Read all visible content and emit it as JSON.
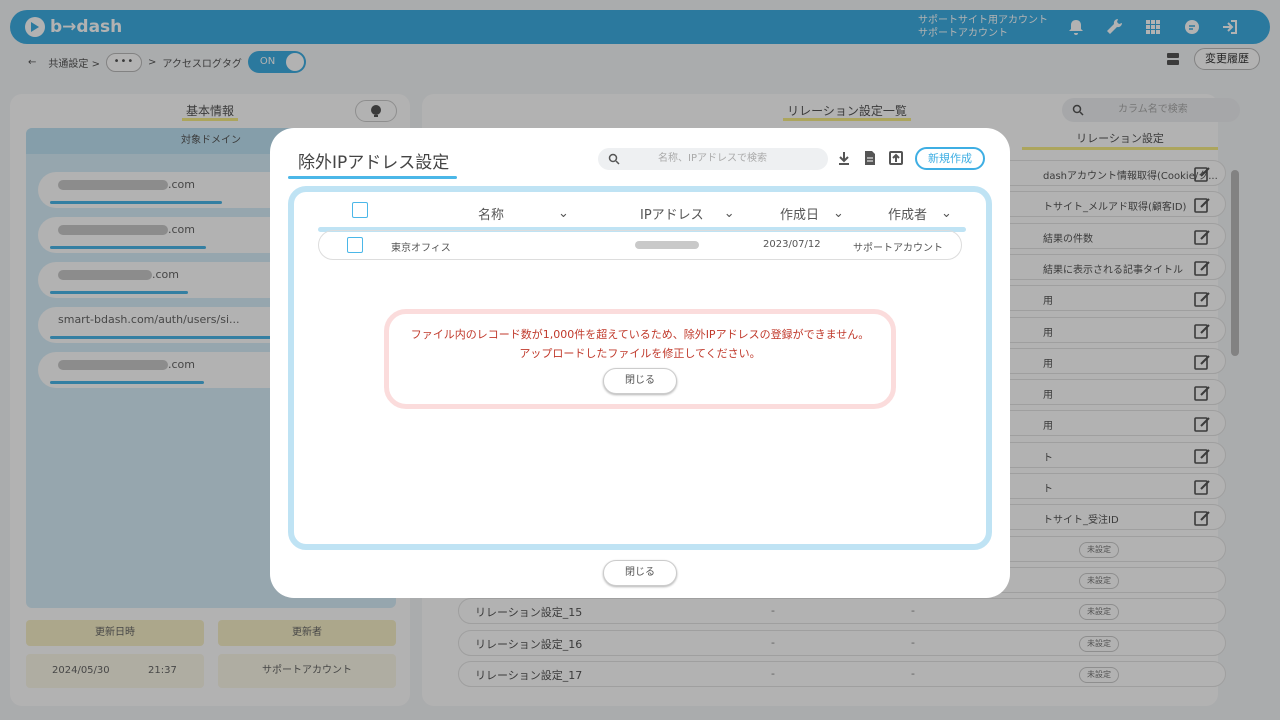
{
  "header": {
    "logo_text": "b→dash",
    "account_line1": "サポートサイト用アカウント",
    "account_line2": "サポートアカウント",
    "accent_color": "#3eaee3"
  },
  "breadcrumb": {
    "back_arrow": "←",
    "common_settings": "共通設定 >",
    "more": "•••",
    "separator": ">",
    "current": "アクセスログタグ",
    "toggle_label": "ON",
    "history_button": "変更履歴"
  },
  "left_panel": {
    "title": "基本情報",
    "domain_header": "対象ドメイン",
    "domains": [
      ".com",
      ".com",
      ".com",
      "smart-bdash.com/auth/users/si...",
      ".com"
    ],
    "updated_at_label": "更新日時",
    "updater_label": "更新者",
    "updated_date": "2024/05/30",
    "updated_time": "21:37",
    "updater": "サポートアカウント"
  },
  "right_panel": {
    "title": "リレーション設定一覧",
    "search_placeholder": "カラム名で検索",
    "column_header": "リレーション設定",
    "rows": [
      {
        "name": "",
        "label": "dashアカウント情報取得(Cookie/ク..."
      },
      {
        "name": "",
        "label": "トサイト_メルアド取得(顧客ID)"
      },
      {
        "name": "",
        "label": "結果の件数"
      },
      {
        "name": "",
        "label": "結果に表示される記事タイトル"
      },
      {
        "name": "",
        "label": "用"
      },
      {
        "name": "",
        "label": "用"
      },
      {
        "name": "",
        "label": "用"
      },
      {
        "name": "",
        "label": "用"
      },
      {
        "name": "",
        "label": "用"
      },
      {
        "name": "",
        "label": "ト"
      },
      {
        "name": "",
        "label": "ト"
      },
      {
        "name": "",
        "label": "トサイト_受注ID"
      },
      {
        "name": "",
        "label": "未設定"
      },
      {
        "name": "",
        "label": "未設定"
      },
      {
        "name": "リレーション設定_15",
        "label": "未設定"
      },
      {
        "name": "リレーション設定_16",
        "label": "未設定"
      },
      {
        "name": "リレーション設定_17",
        "label": "未設定"
      }
    ],
    "dash": "-"
  },
  "modal": {
    "title": "除外IPアドレス設定",
    "search_placeholder": "名称、IPアドレスで検索",
    "new_button": "新規作成",
    "columns": [
      "名称",
      "IPアドレス",
      "作成日",
      "作成者"
    ],
    "rows": [
      {
        "name": "東京オフィス",
        "created": "2023/07/12",
        "creator": "サポートアカウント"
      }
    ],
    "close_button": "閉じる"
  },
  "alert": {
    "line1": "ファイル内のレコード数が1,000件を超えているため、除外IPアドレスの登録ができません。",
    "line2": "アップロードしたファイルを修正してください。",
    "close_button": "閉じる"
  }
}
